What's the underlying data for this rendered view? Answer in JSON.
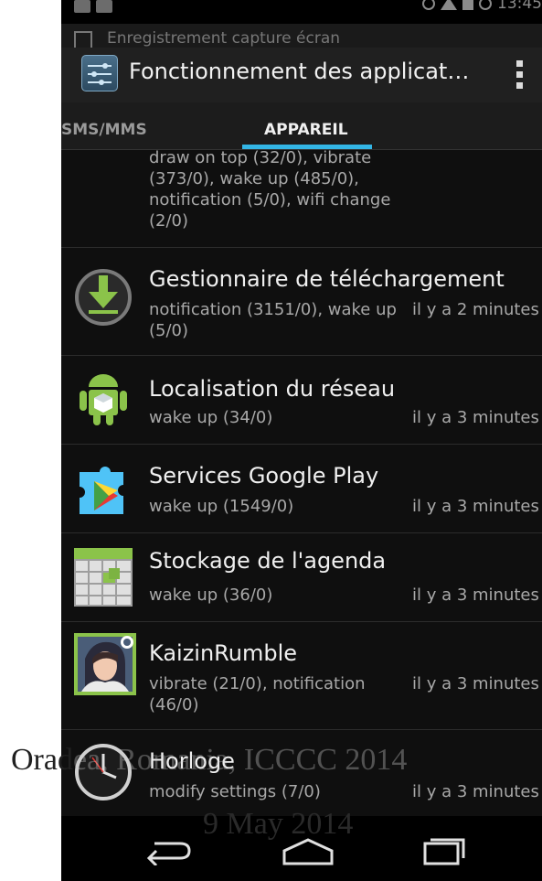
{
  "status_bar": {
    "clock": "13:45"
  },
  "notification": {
    "text": "Enregistrement capture écran"
  },
  "action_bar": {
    "title": "Fonctionnement des applicat…"
  },
  "tabs": [
    {
      "label": "SMS/MMS",
      "selected": false
    },
    {
      "label": "APPAREIL",
      "selected": true
    }
  ],
  "list": [
    {
      "name": "",
      "ops": "draw on top (32/0), vibrate (373/0), wake up (485/0), notification (5/0), wifi change (2/0)",
      "time": ""
    },
    {
      "name": "Gestionnaire de téléchargement",
      "ops": "notification (3151/0), wake up (5/0)",
      "time": "il y a 2 minutes",
      "icon": "download-icon"
    },
    {
      "name": "Localisation du réseau",
      "ops": "wake up (34/0)",
      "time": "il y a 3 minutes",
      "icon": "android-icon"
    },
    {
      "name": "Services Google Play",
      "ops": "wake up (1549/0)",
      "time": "il y a 3 minutes",
      "icon": "google-play-services-icon"
    },
    {
      "name": "Stockage de l'agenda",
      "ops": "wake up (36/0)",
      "time": "il y a 3 minutes",
      "icon": "calendar-storage-icon"
    },
    {
      "name": "KaizinRumble",
      "ops": "vibrate (21/0), notification (46/0)",
      "time": "il y a 3 minutes",
      "icon": "game-avatar-icon"
    },
    {
      "name": "Horloge",
      "ops": "modify settings (7/0)",
      "time": "il y a 3 minutes",
      "icon": "clock-icon"
    }
  ],
  "watermark": {
    "line1_a": "Orad",
    "line1_b": "ea, Romania, ICCCC 2014",
    "line2": "9 May 2014"
  },
  "colors": {
    "accent": "#33b5e5",
    "background": "#0f0f0f"
  }
}
